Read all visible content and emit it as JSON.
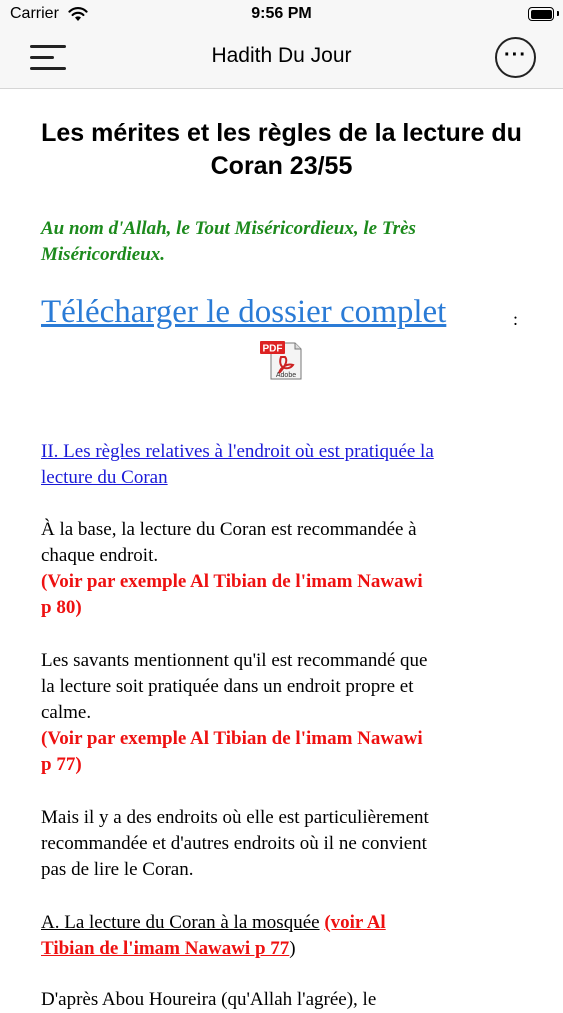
{
  "status_bar": {
    "carrier": "Carrier",
    "time": "9:56 PM"
  },
  "nav": {
    "title": "Hadith Du Jour",
    "more_label": "···"
  },
  "content": {
    "title_line1": "Les mérites et les règles de la lecture du",
    "title_line2": "Coran 23/55",
    "basmala_line1": "Au nom d'Allah, le Tout Miséricordieux, le Très",
    "basmala_line2": "Miséricordieux.",
    "download_link": "Télécharger le dossier complet",
    "colon": ":",
    "section_link_line1": "II. Les règles relatives à l'endroit où est pratiquée la",
    "section_link_line2": "lecture du Coran",
    "p1_line1": "À la base, la lecture du Coran est recommandée à",
    "p1_line2": "chaque endroit.",
    "ref1_line1": "(Voir par exemple Al Tibian de l'imam Nawawi",
    "ref1_line2": "p 80)",
    "p2_line1": "Les savants mentionnent qu'il est recommandé que",
    "p2_line2": "la lecture soit pratiquée dans un endroit propre et",
    "p2_line3": "calme.",
    "ref2_line1": "(Voir par exemple Al Tibian de l'imam Nawawi",
    "ref2_line2": "p 77)",
    "p3_line1": "Mais il y a des endroits où elle est particulièrement",
    "p3_line2": "recommandée et d'autres endroits où il ne convient",
    "p3_line3": "pas de lire le Coran.",
    "subheading_text": "A. La lecture du Coran à la mosquée",
    "subheading_ref_line1": "(voir Al",
    "subheading_ref_line2": "Tibian de l'imam Nawawi p 77",
    "subheading_close": ")",
    "partial_line": "D'après Abou Houreira (qu'Allah l'agrée), le"
  },
  "colors": {
    "basmala": "#1c8a1c",
    "reference": "#e11111",
    "link": "#2a7bd6",
    "section_link": "#1a1ad8"
  },
  "icons": {
    "menu": "hamburger-icon",
    "more": "ellipsis-circle-icon",
    "pdf": "pdf-file-icon",
    "wifi": "wifi-icon",
    "battery": "battery-icon"
  }
}
